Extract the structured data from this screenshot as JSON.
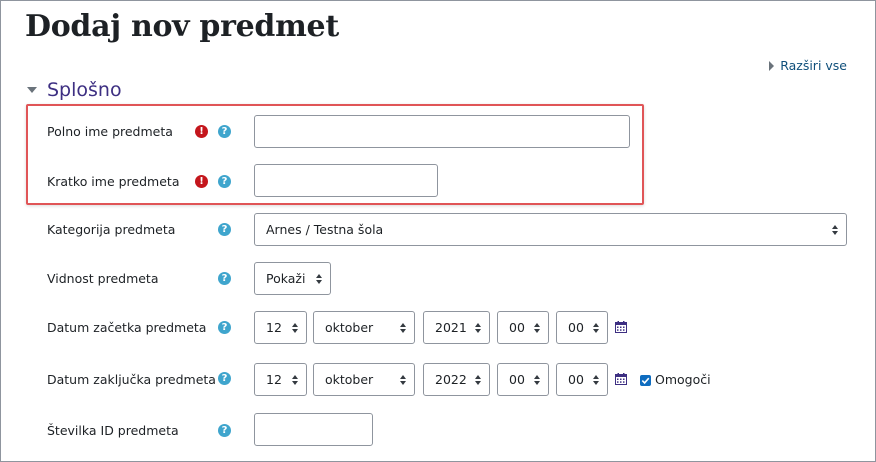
{
  "page": {
    "title": "Dodaj nov predmet",
    "expand_all": "Razširi vse"
  },
  "section": {
    "label": "Splošno"
  },
  "fields": {
    "fullname": {
      "label": "Polno ime predmeta",
      "value": ""
    },
    "shortname": {
      "label": "Kratko ime predmeta",
      "value": ""
    },
    "category": {
      "label": "Kategorija predmeta",
      "value": "Arnes / Testna šola"
    },
    "visibility": {
      "label": "Vidnost predmeta",
      "value": "Pokaži"
    },
    "startdate": {
      "label": "Datum začetka predmeta",
      "day": "12",
      "month": "oktober",
      "year": "2021",
      "hour": "00",
      "minute": "00"
    },
    "enddate": {
      "label": "Datum zaključka predmeta",
      "day": "12",
      "month": "oktober",
      "year": "2022",
      "hour": "00",
      "minute": "00",
      "enable_label": "Omogoči",
      "enabled": true
    },
    "idnumber": {
      "label": "Številka ID predmeta",
      "value": ""
    }
  },
  "icons": {
    "required": "!",
    "help": "?"
  },
  "colors": {
    "required": "#c4161c",
    "help": "#3fa5cd",
    "section": "#3d2f82",
    "highlight": "#e05557",
    "checkbox": "#0f6cbf"
  }
}
